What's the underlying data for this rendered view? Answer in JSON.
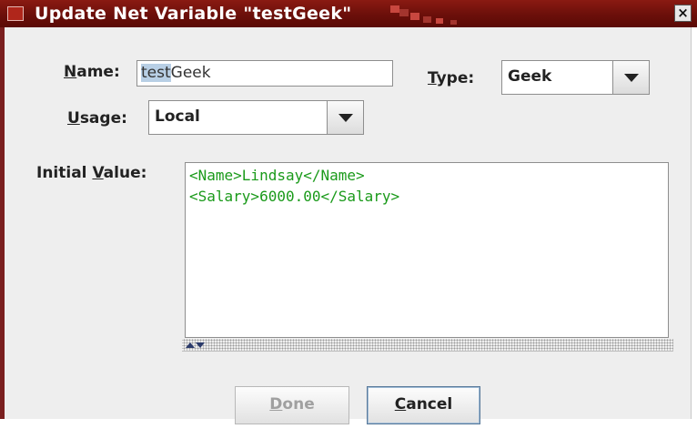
{
  "dialog": {
    "title": "Update Net Variable \"testGeek\"",
    "close_glyph": "×",
    "accent_color": "#7a1f1f"
  },
  "form": {
    "name_label_mnemonic": "N",
    "name_label_rest": "ame:",
    "name_value_selected": "test",
    "name_value_rest": "Geek",
    "type_label_mnemonic": "T",
    "type_label_rest": "ype:",
    "type_value": "Geek",
    "usage_label_mnemonic": "U",
    "usage_label_rest": "sage:",
    "usage_value": "Local",
    "initial_value_label_pre": "Initial ",
    "initial_value_label_mnemonic": "V",
    "initial_value_label_rest": "alue:",
    "initial_value_lines": [
      "<Name>Lindsay</Name>",
      "<Salary>6000.00</Salary>"
    ],
    "value_text_color": "#1a9a1a"
  },
  "buttons": {
    "done_mnemonic": "D",
    "done_rest": "one",
    "cancel_mnemonic": "C",
    "cancel_rest": "ancel"
  },
  "icons": {
    "app": "app-icon",
    "close": "close-icon",
    "dropdown": "chevron-down-icon",
    "splitter": "splitter-arrows-icon"
  }
}
